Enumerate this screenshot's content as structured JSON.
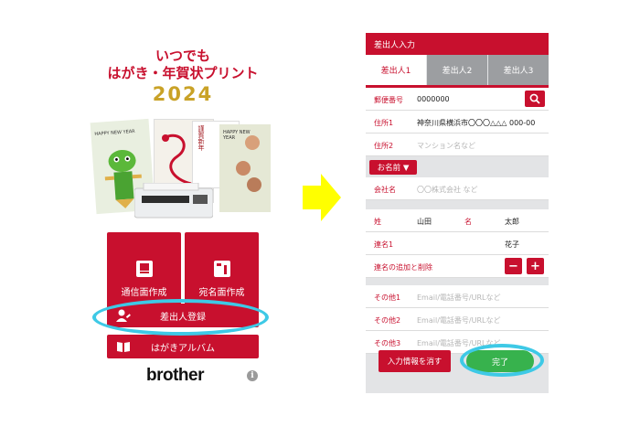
{
  "left": {
    "title_line1": "いつでも",
    "title_line2": "はがき・年賀状プリント",
    "year": "2024",
    "card_text_1": "HAPPY NEW YEAR",
    "card_text_2": "謹賀新年",
    "card_text_3": "HAPPY NEW YEAR",
    "buttons": {
      "message_side": "通信面作成",
      "address_side": "宛名面作成",
      "sender_register": "差出人登録",
      "album": "はがきアルバム"
    },
    "brand": "brother",
    "info_icon_glyph": "i"
  },
  "arrow": {
    "color": "#ffff00"
  },
  "right": {
    "header": "差出人入力",
    "tabs": [
      "差出人1",
      "差出人2",
      "差出人3"
    ],
    "postal": {
      "label": "郵便番号",
      "value": "0000000"
    },
    "address1": {
      "label": "住所1",
      "value": "神奈川県横浜市〇〇〇△△△ 000-00"
    },
    "address2": {
      "label": "住所2",
      "placeholder": "マンション名など"
    },
    "name_toggle": "お名前 ▼",
    "company": {
      "label": "会社名",
      "placeholder": "〇〇株式会社 など"
    },
    "surname": {
      "label": "姓",
      "value": "山田"
    },
    "given_name": {
      "label": "名",
      "value": "太郎"
    },
    "joint_name": {
      "label": "連名1",
      "value": "花子"
    },
    "joint_add_remove": {
      "label": "連名の追加と削除",
      "minus": "−",
      "plus": "+"
    },
    "other1": {
      "label": "その他1",
      "placeholder": "Email/電話番号/URLなど"
    },
    "other2": {
      "label": "その他2",
      "placeholder": "Email/電話番号/URLなど"
    },
    "other3": {
      "label": "その他3",
      "placeholder": "Email/電話番号/URLなど"
    },
    "clear_button": "入力情報を消す",
    "done_button": "完了"
  },
  "colors": {
    "brand_red": "#c8102e",
    "gold": "#c9a227",
    "highlight": "#3ec9e6",
    "done_green": "#37b24d",
    "tab_gray": "#9c9ea1"
  }
}
